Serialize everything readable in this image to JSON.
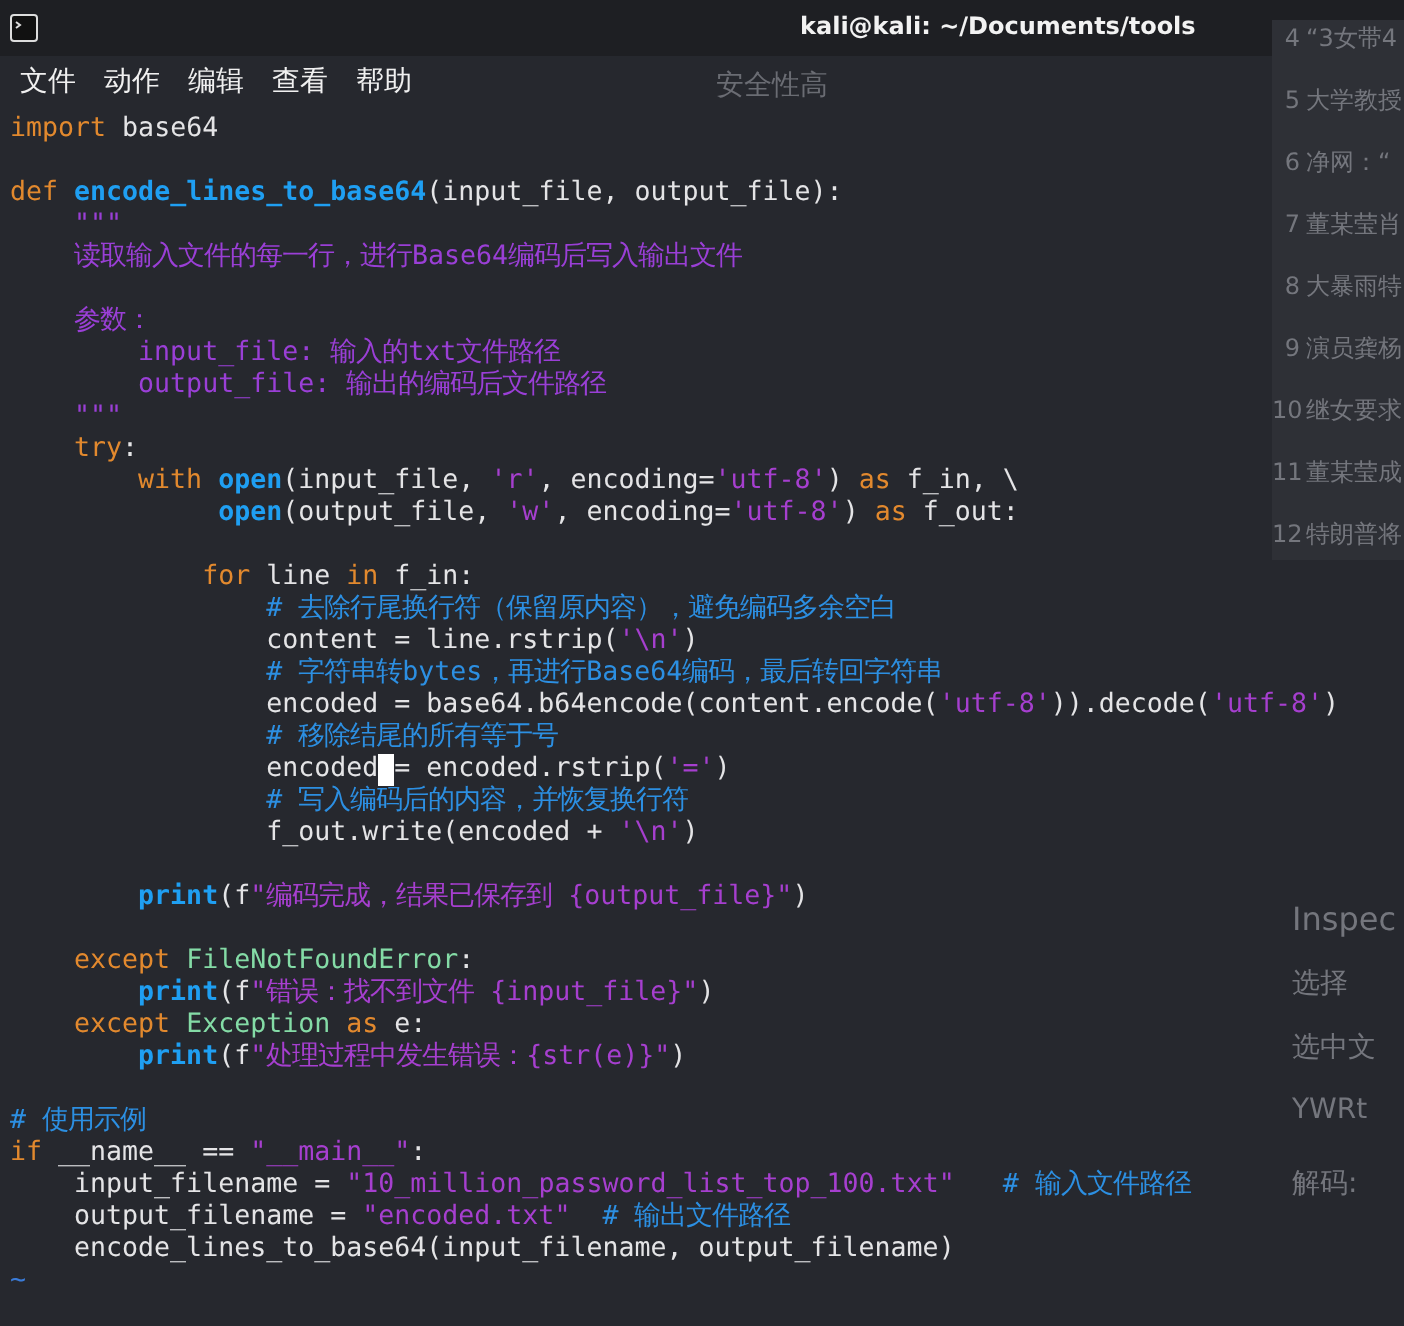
{
  "window": {
    "title": "kali@kali: ~/Documents/tools"
  },
  "menu": [
    "文件",
    "动作",
    "编辑",
    "查看",
    "帮助"
  ],
  "background_window": {
    "heading": "安全性高",
    "list": [
      {
        "number": "4",
        "text": "“3女带4"
      },
      {
        "number": "5",
        "text": "大学教授"
      },
      {
        "number": "6",
        "text": "净网：“"
      },
      {
        "number": "7",
        "text": "董某莹肖"
      },
      {
        "number": "8",
        "text": "大暴雨特"
      },
      {
        "number": "9",
        "text": "演员龚杨"
      },
      {
        "number": "10",
        "text": "继女要求"
      },
      {
        "number": "11",
        "text": "董某莹成"
      },
      {
        "number": "12",
        "text": "特朗普将"
      }
    ],
    "panel": [
      "Inspec",
      "选择",
      "选中文",
      "YWRt",
      "解码:"
    ]
  },
  "lines": [
    {
      "kind": "code",
      "segments": [
        {
          "kind": "keyword",
          "text": "import"
        },
        {
          "kind": "plain",
          "text": " base64"
        }
      ]
    },
    {
      "kind": "blank"
    },
    {
      "kind": "code",
      "segments": [
        {
          "kind": "keyword",
          "text": "def"
        },
        {
          "kind": "defname",
          "text": " encode_lines_to_base64"
        },
        {
          "kind": "plain",
          "text": "(input_file, output_file):"
        }
      ]
    },
    {
      "kind": "code",
      "segments": [
        {
          "kind": "docstring",
          "text": "    \"\"\""
        }
      ]
    },
    {
      "kind": "code",
      "segments": [
        {
          "kind": "docstring",
          "text": "    读取输入文件的每一行，进行Base64编码后写入输出文件"
        }
      ]
    },
    {
      "kind": "blank"
    },
    {
      "kind": "code",
      "segments": [
        {
          "kind": "docstring",
          "text": "    参数："
        }
      ]
    },
    {
      "kind": "code",
      "segments": [
        {
          "kind": "docstring",
          "text": "        input_file: 输入的txt文件路径"
        }
      ]
    },
    {
      "kind": "code",
      "segments": [
        {
          "kind": "docstring",
          "text": "        output_file: 输出的编码后文件路径"
        }
      ]
    },
    {
      "kind": "code",
      "segments": [
        {
          "kind": "docstring",
          "text": "    \"\"\""
        }
      ]
    },
    {
      "kind": "code",
      "segments": [
        {
          "kind": "keyword",
          "text": "    try"
        },
        {
          "kind": "plain",
          "text": ":"
        }
      ]
    },
    {
      "kind": "code",
      "segments": [
        {
          "kind": "keyword",
          "text": "        with"
        },
        {
          "kind": "builtin",
          "text": " open"
        },
        {
          "kind": "plain",
          "text": "(input_file, "
        },
        {
          "kind": "string",
          "text": "'r'"
        },
        {
          "kind": "plain",
          "text": ", encoding="
        },
        {
          "kind": "string",
          "text": "'utf-8'"
        },
        {
          "kind": "plain",
          "text": ") "
        },
        {
          "kind": "keyword",
          "text": "as"
        },
        {
          "kind": "plain",
          "text": " f_in, \\"
        }
      ]
    },
    {
      "kind": "code",
      "segments": [
        {
          "kind": "builtin",
          "text": "             open"
        },
        {
          "kind": "plain",
          "text": "(output_file, "
        },
        {
          "kind": "string",
          "text": "'w'"
        },
        {
          "kind": "plain",
          "text": ", encoding="
        },
        {
          "kind": "string",
          "text": "'utf-8'"
        },
        {
          "kind": "plain",
          "text": ") "
        },
        {
          "kind": "keyword",
          "text": "as"
        },
        {
          "kind": "plain",
          "text": " f_out:"
        }
      ]
    },
    {
      "kind": "blank"
    },
    {
      "kind": "code",
      "segments": [
        {
          "kind": "keyword",
          "text": "            for"
        },
        {
          "kind": "plain",
          "text": " line "
        },
        {
          "kind": "keyword",
          "text": "in"
        },
        {
          "kind": "plain",
          "text": " f_in:"
        }
      ]
    },
    {
      "kind": "code",
      "segments": [
        {
          "kind": "comment",
          "text": "                # 去除行尾换行符（保留原内容），避免编码多余空白"
        }
      ]
    },
    {
      "kind": "code",
      "segments": [
        {
          "kind": "plain",
          "text": "                content = line.rstrip("
        },
        {
          "kind": "string",
          "text": "'\\n'"
        },
        {
          "kind": "plain",
          "text": ")"
        }
      ]
    },
    {
      "kind": "code",
      "segments": [
        {
          "kind": "comment",
          "text": "                # 字符串转bytes，再进行Base64编码，最后转回字符串"
        }
      ]
    },
    {
      "kind": "code",
      "segments": [
        {
          "kind": "plain",
          "text": "                encoded = base64.b64encode(content.encode("
        },
        {
          "kind": "string",
          "text": "'utf-8'"
        },
        {
          "kind": "plain",
          "text": ")).decode("
        },
        {
          "kind": "string",
          "text": "'utf-8'"
        },
        {
          "kind": "plain",
          "text": ")"
        }
      ]
    },
    {
      "kind": "code",
      "segments": [
        {
          "kind": "comment",
          "text": "                # 移除结尾的所有等于号"
        }
      ]
    },
    {
      "kind": "code",
      "segments": [
        {
          "kind": "plain",
          "text": "                encoded"
        },
        {
          "kind": "plain",
          "text": " = encoded.rstrip(",
          "cursor": true
        },
        {
          "kind": "string",
          "text": "'='"
        },
        {
          "kind": "plain",
          "text": ")"
        }
      ]
    },
    {
      "kind": "code",
      "segments": [
        {
          "kind": "comment",
          "text": "                # 写入编码后的内容，并恢复换行符"
        }
      ]
    },
    {
      "kind": "code",
      "segments": [
        {
          "kind": "plain",
          "text": "                f_out.write(encoded + "
        },
        {
          "kind": "string",
          "text": "'\\n'"
        },
        {
          "kind": "plain",
          "text": ")"
        }
      ]
    },
    {
      "kind": "blank"
    },
    {
      "kind": "code",
      "segments": [
        {
          "kind": "builtin",
          "text": "        print"
        },
        {
          "kind": "plain",
          "text": "(f"
        },
        {
          "kind": "string",
          "text": "\"编码完成，结果已保存到 {output_file}\""
        },
        {
          "kind": "plain",
          "text": ")"
        }
      ]
    },
    {
      "kind": "blank"
    },
    {
      "kind": "code",
      "segments": [
        {
          "kind": "keyword",
          "text": "    except"
        },
        {
          "kind": "classname",
          "text": " FileNotFoundError"
        },
        {
          "kind": "plain",
          "text": ":"
        }
      ]
    },
    {
      "kind": "code",
      "segments": [
        {
          "kind": "builtin",
          "text": "        print"
        },
        {
          "kind": "plain",
          "text": "(f"
        },
        {
          "kind": "string",
          "text": "\"错误：找不到文件 {input_file}\""
        },
        {
          "kind": "plain",
          "text": ")"
        }
      ]
    },
    {
      "kind": "code",
      "segments": [
        {
          "kind": "keyword",
          "text": "    except"
        },
        {
          "kind": "classname",
          "text": " Exception"
        },
        {
          "kind": "keyword",
          "text": " as"
        },
        {
          "kind": "plain",
          "text": " e:"
        }
      ]
    },
    {
      "kind": "code",
      "segments": [
        {
          "kind": "builtin",
          "text": "        print"
        },
        {
          "kind": "plain",
          "text": "(f"
        },
        {
          "kind": "string",
          "text": "\"处理过程中发生错误：{str(e)}\""
        },
        {
          "kind": "plain",
          "text": ")"
        }
      ]
    },
    {
      "kind": "blank"
    },
    {
      "kind": "code",
      "segments": [
        {
          "kind": "comment",
          "text": "# 使用示例"
        }
      ]
    },
    {
      "kind": "code",
      "segments": [
        {
          "kind": "keyword",
          "text": "if"
        },
        {
          "kind": "plain",
          "text": " __name__ == "
        },
        {
          "kind": "string",
          "text": "\"__main__\""
        },
        {
          "kind": "plain",
          "text": ":"
        }
      ]
    },
    {
      "kind": "code",
      "segments": [
        {
          "kind": "plain",
          "text": "    input_filename = "
        },
        {
          "kind": "string",
          "text": "\"10_million_password_list_top_100.txt\""
        },
        {
          "kind": "comment",
          "text": "   # 输入文件路径"
        }
      ]
    },
    {
      "kind": "code",
      "segments": [
        {
          "kind": "plain",
          "text": "    output_filename = "
        },
        {
          "kind": "string",
          "text": "\"encoded.txt\""
        },
        {
          "kind": "comment",
          "text": "  # 输出文件路径"
        }
      ]
    },
    {
      "kind": "code",
      "segments": [
        {
          "kind": "plain",
          "text": "    encode_lines_to_base64(input_filename, output_filename)"
        }
      ]
    },
    {
      "kind": "code",
      "segments": [
        {
          "kind": "tilde",
          "text": "~"
        }
      ]
    }
  ]
}
